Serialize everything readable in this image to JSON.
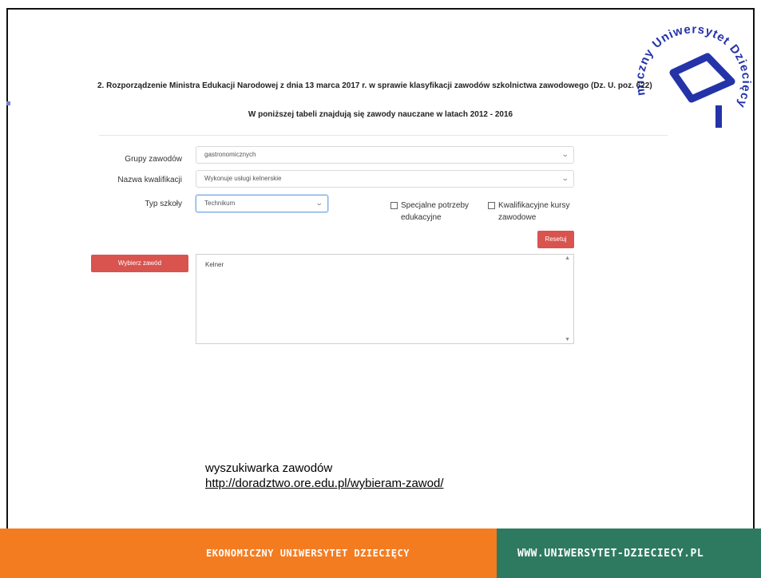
{
  "logo": {
    "text": "miczny Uniwersytet Dziecięcy"
  },
  "heading": {
    "regulation": "2. Rozporządzenie Ministra Edukacji Narodowej z dnia 13 marca 2017 r. w sprawie klasyfikacji zawodów szkolnictwa zawodowego (Dz. U. poz. 622)",
    "table_caption": "W poniższej tabeli znajdują się zawody nauczane w latach 2012 - 2016"
  },
  "form": {
    "groups_label": "Grupy zawodów",
    "groups_value": "gastronomicznych",
    "qualification_label": "Nazwa kwalifikacji",
    "qualification_value": "Wykonuje usługi kelnerskie",
    "school_label": "Typ szkoły",
    "school_value": "Technikum",
    "special_needs_label": "Specjalne potrzeby edukacyjne",
    "courses_label": "Kwalifikacyjne kursy zawodowe",
    "reset_button": "Resetuj",
    "choose_button": "Wybierz zawód",
    "results": [
      "Kelner"
    ]
  },
  "note": {
    "text": "wyszukiwarka zawodów",
    "link": "http://doradztwo.ore.edu.pl/wybieram-zawod/"
  },
  "footer": {
    "left": "EKONOMICZNY UNIWERSYTET DZIECIĘCY",
    "right": "WWW.UNIWERSYTET-DZIECIECY.PL",
    "left_color": "#f47c20",
    "right_color": "#2e7a60"
  },
  "colors": {
    "accent_red": "#d9534f",
    "logo_blue": "#2433a8"
  }
}
